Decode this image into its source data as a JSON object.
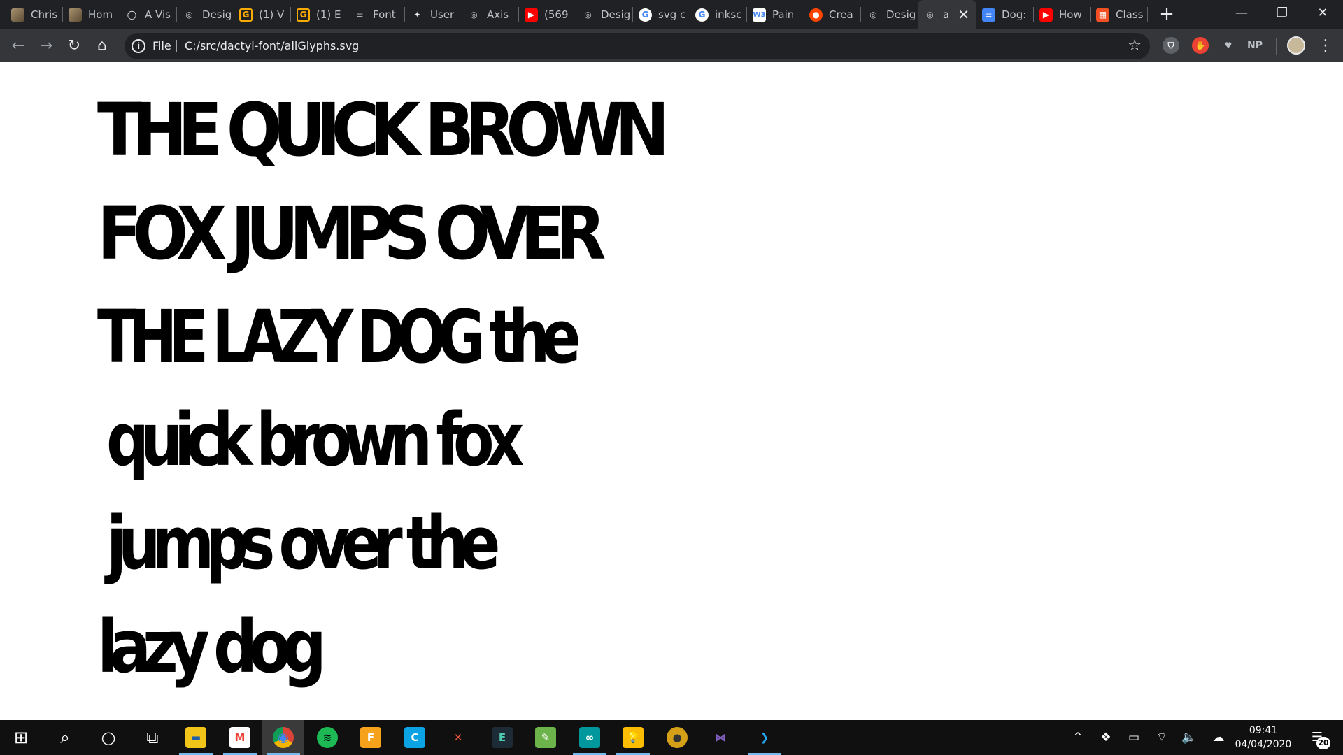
{
  "browser": {
    "tabs": [
      {
        "title": "Chris",
        "icon": "photo-icon",
        "color": "#8b7a5a",
        "glyph": ""
      },
      {
        "title": "Hom",
        "icon": "photo-icon",
        "color": "#8b7a5a",
        "glyph": ""
      },
      {
        "title": "A Vis",
        "icon": "circle-icon",
        "color": "#202124",
        "glyph": "◯"
      },
      {
        "title": "Desig",
        "icon": "globe-icon",
        "color": "#5f6368",
        "glyph": "◎"
      },
      {
        "title": "(1) V",
        "icon": "g-icon",
        "color": "#f9ab00",
        "glyph": "G"
      },
      {
        "title": "(1) E",
        "icon": "g-icon",
        "color": "#f9ab00",
        "glyph": "G"
      },
      {
        "title": "Font",
        "icon": "sliders-icon",
        "color": "#5f6368",
        "glyph": "≡"
      },
      {
        "title": "User",
        "icon": "ink-icon",
        "color": "#e8eaed",
        "glyph": "✦"
      },
      {
        "title": "Axis",
        "icon": "globe-icon",
        "color": "#5f6368",
        "glyph": "◎"
      },
      {
        "title": "(569",
        "icon": "youtube-icon",
        "color": "#ff0000",
        "glyph": "▶"
      },
      {
        "title": "Desig",
        "icon": "globe-icon",
        "color": "#5f6368",
        "glyph": "◎"
      },
      {
        "title": "svg c",
        "icon": "google-icon",
        "color": "#ffffff",
        "glyph": "G"
      },
      {
        "title": "inksc",
        "icon": "google-icon",
        "color": "#ffffff",
        "glyph": "G"
      },
      {
        "title": "Pain",
        "icon": "w3-icon",
        "color": "#ffffff",
        "glyph": "W3"
      },
      {
        "title": "Crea",
        "icon": "reddit-icon",
        "color": "#ff4500",
        "glyph": "●"
      },
      {
        "title": "Desig",
        "icon": "globe-icon",
        "color": "#5f6368",
        "glyph": "◎"
      },
      {
        "title": "a",
        "icon": "globe-icon",
        "color": "#5f6368",
        "glyph": "◎",
        "active": true
      },
      {
        "title": "Dog:",
        "icon": "docs-icon",
        "color": "#4285f4",
        "glyph": "≡"
      },
      {
        "title": "How",
        "icon": "youtube-icon",
        "color": "#ff0000",
        "glyph": "▶"
      },
      {
        "title": "Class",
        "icon": "microsoft-icon",
        "color": "#f25022",
        "glyph": "▦"
      }
    ],
    "new_tab": "+",
    "window": {
      "minimize": "—",
      "restore": "❐",
      "close": "✕"
    },
    "nav": {
      "back": "←",
      "forward": "→",
      "reload": "↻",
      "home": "⌂"
    },
    "omnibox": {
      "info": "i",
      "scheme": "File",
      "url": "C:/src/dactyl-font/allGlyphs.svg",
      "star": "☆"
    },
    "extensions": [
      {
        "name": "shield-extension",
        "glyph": "⛉",
        "bg": "#5f6368",
        "fg": "#ffffff"
      },
      {
        "name": "red-extension",
        "glyph": "✋",
        "bg": "#ea4335",
        "fg": "#ffffff"
      },
      {
        "name": "puzzle-extension",
        "glyph": "♥",
        "bg": "#35363a",
        "fg": "#bdc1c6"
      },
      {
        "name": "np-extension",
        "glyph": "NP",
        "bg": "#35363a",
        "fg": "#bdc1c6"
      }
    ],
    "menu": "⋮"
  },
  "document": {
    "lines": [
      "THE QUICK BROWN",
      "FOX JUMPS OVER",
      "THE LAZY DOG the",
      "quick brown fox",
      "jumps over the",
      "lazy dog"
    ]
  },
  "taskbar": {
    "apps": [
      {
        "name": "start-button",
        "glyph": "⊞",
        "color": "#101010",
        "fg": "#ffffff"
      },
      {
        "name": "search-button",
        "glyph": "⌕",
        "color": "#101010",
        "fg": "#ffffff"
      },
      {
        "name": "cortana-button",
        "glyph": "○",
        "color": "#101010",
        "fg": "#ffffff"
      },
      {
        "name": "task-view-button",
        "glyph": "⧉",
        "color": "#101010",
        "fg": "#ffffff"
      },
      {
        "name": "file-explorer-app",
        "glyph": "▬",
        "color": "#f0c419",
        "fg": "#1e5fa8",
        "open": true
      },
      {
        "name": "gmail-app",
        "glyph": "M",
        "color": "#ffffff",
        "fg": "#ea4335",
        "open": true
      },
      {
        "name": "chrome-app",
        "glyph": "◉",
        "color": "#db4437",
        "fg": "#fbbc05",
        "open": true
      },
      {
        "name": "spotify-app",
        "glyph": "≋",
        "color": "#1db954",
        "fg": "#000000"
      },
      {
        "name": "fusion-app",
        "glyph": "F",
        "color": "#f7a21b",
        "fg": "#ffffff"
      },
      {
        "name": "cmd-app",
        "glyph": "C",
        "color": "#0ba3e3",
        "fg": "#ffffff"
      },
      {
        "name": "xmind-app",
        "glyph": "✕",
        "color": "#101010",
        "fg": "#e8533a"
      },
      {
        "name": "editor-app",
        "glyph": "E",
        "color": "#1d2b36",
        "fg": "#4ec9b0"
      },
      {
        "name": "paint-app",
        "glyph": "✎",
        "color": "#6bb34a",
        "fg": "#ffffff"
      },
      {
        "name": "arduino-app",
        "glyph": "∞",
        "color": "#00979d",
        "fg": "#ffffff",
        "open": true
      },
      {
        "name": "keep-app",
        "glyph": "💡",
        "color": "#fbbc04",
        "fg": "#ffffff",
        "open": true
      },
      {
        "name": "ball-app",
        "glyph": "●",
        "color": "#d4a017",
        "fg": "#333333"
      },
      {
        "name": "visual-studio-app",
        "glyph": "⋈",
        "color": "#101010",
        "fg": "#8661c5"
      },
      {
        "name": "vscode-app",
        "glyph": "❯",
        "color": "#101010",
        "fg": "#23a9f2",
        "open": true
      }
    ],
    "tray": {
      "chevron": "^",
      "dropbox": "❖",
      "battery": "▭",
      "wifi": "⌔",
      "volume": "🔈",
      "onedrive": "☁"
    },
    "time": "09:41",
    "date": "04/04/2020",
    "notifications": "20",
    "notification_glyph": "☰"
  }
}
